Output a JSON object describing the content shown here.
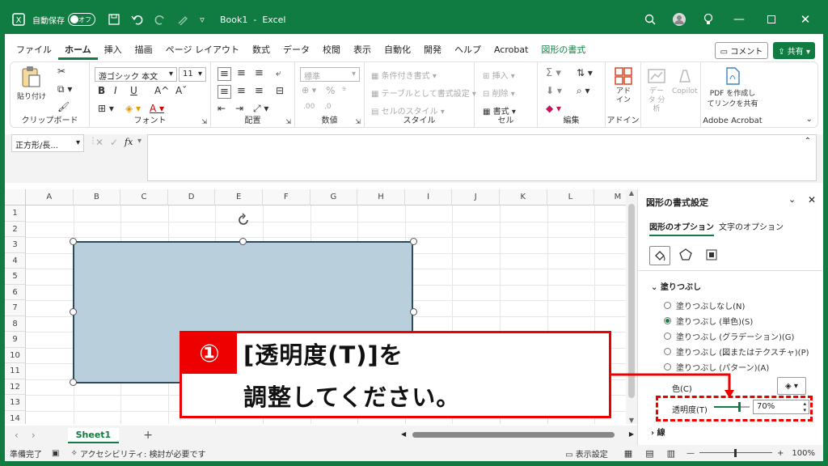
{
  "titlebar": {
    "autosave_label": "自動保存",
    "autosave_state": "オフ",
    "doc_title": "Book1  -  Excel"
  },
  "menu": {
    "tabs": [
      "ファイル",
      "ホーム",
      "挿入",
      "描画",
      "ページ レイアウト",
      "数式",
      "データ",
      "校閲",
      "表示",
      "自動化",
      "開発",
      "ヘルプ",
      "Acrobat",
      "図形の書式"
    ],
    "active": 1,
    "comment_label": "コメント",
    "share_label": "共有"
  },
  "ribbon": {
    "clipboard": {
      "label": "クリップボード",
      "paste": "貼り付け"
    },
    "font": {
      "label": "フォント",
      "name": "游ゴシック 本文",
      "size": "11",
      "bold": "B",
      "italic": "I",
      "underline": "U",
      "grow": "A^",
      "shrink": "Aˇ"
    },
    "alignment": {
      "label": "配置"
    },
    "number": {
      "label": "数値",
      "format": "標準"
    },
    "styles": {
      "label": "スタイル",
      "conditional": "条件付き書式",
      "table": "テーブルとして書式設定",
      "cell_styles": "セルのスタイル"
    },
    "cells": {
      "label": "セル",
      "insert": "挿入",
      "delete": "削除",
      "format": "書式"
    },
    "editing": {
      "label": "編集"
    },
    "addins": {
      "label": "アドイン",
      "addin": "アド イン"
    },
    "extra": {
      "data_analysis": "データ 分析",
      "copilot": "Copilot"
    },
    "acrobat": {
      "label": "Adobe Acrobat",
      "pdf_line1": "PDF を作成し",
      "pdf_line2": "てリンクを共有"
    }
  },
  "formula": {
    "namebox": "正方形/長...",
    "fx": "fx"
  },
  "grid": {
    "columns": [
      "A",
      "B",
      "C",
      "D",
      "E",
      "F",
      "G",
      "H",
      "I",
      "J",
      "K",
      "L",
      "M"
    ],
    "rows": [
      "1",
      "2",
      "3",
      "4",
      "5",
      "6",
      "7",
      "8",
      "9",
      "10",
      "11",
      "12",
      "13",
      "14"
    ]
  },
  "sheets": {
    "active": "Sheet1",
    "add": "+"
  },
  "status": {
    "ready": "準備完了",
    "accessibility": "アクセシビリティ: 検討が必要です",
    "display_settings": "表示設定",
    "zoom": "100%"
  },
  "pane": {
    "title": "図形の書式設定",
    "tab_shape": "図形のオプション",
    "tab_text": "文字のオプション",
    "fill_section": "塗りつぶし",
    "options": [
      "塗りつぶしなし(N)",
      "塗りつぶし (単色)(S)",
      "塗りつぶし (グラデーション)(G)",
      "塗りつぶし (図またはテクスチャ)(P)",
      "塗りつぶし (パターン)(A)"
    ],
    "selected": 1,
    "color_label": "色(C)",
    "transparency_label": "透明度(T)",
    "transparency_value": "70%",
    "transparency_level": 0.7,
    "line_section": "線"
  },
  "callout": {
    "number": "①",
    "line1": "[透明度(T)]を",
    "line2": "調整してください。"
  },
  "colors": {
    "accent": "#107c41",
    "highlight": "#e60000",
    "shape_fill": "#b9cfdb"
  }
}
